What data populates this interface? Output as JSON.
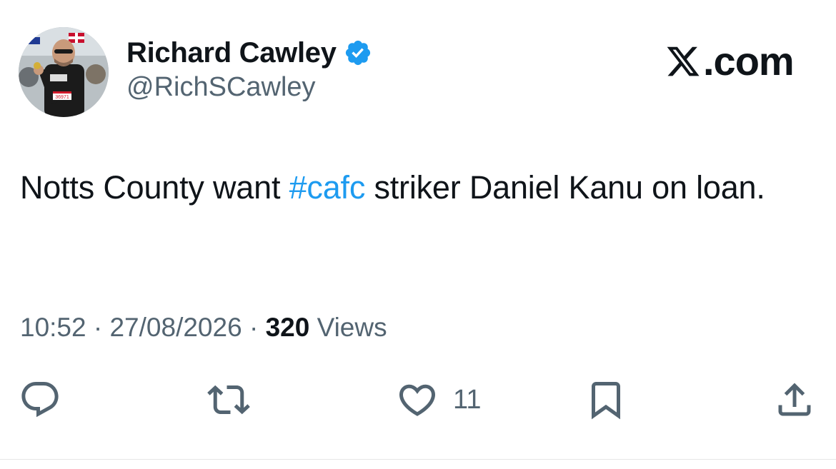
{
  "author": {
    "display_name": "Richard Cawley",
    "handle": "@RichSCawley",
    "verified": true,
    "avatar_bib_number": "36971"
  },
  "brand": {
    "logo_letter": "X",
    "domain_suffix": ".com"
  },
  "tweet": {
    "text_before": "Notts County want ",
    "hashtag": "#cafc",
    "text_after": " striker Daniel Kanu on loan."
  },
  "meta": {
    "time": "10:52",
    "separator": " · ",
    "date": "27/08/2026",
    "views_count": "320",
    "views_label": " Views"
  },
  "actions": {
    "reply_icon": "reply-icon",
    "repost_icon": "repost-icon",
    "like_icon": "heart-icon",
    "like_count": "11",
    "bookmark_icon": "bookmark-icon",
    "share_icon": "share-icon"
  },
  "colors": {
    "text": "#0f1419",
    "secondary": "#536471",
    "accent": "#1d9bf0"
  }
}
